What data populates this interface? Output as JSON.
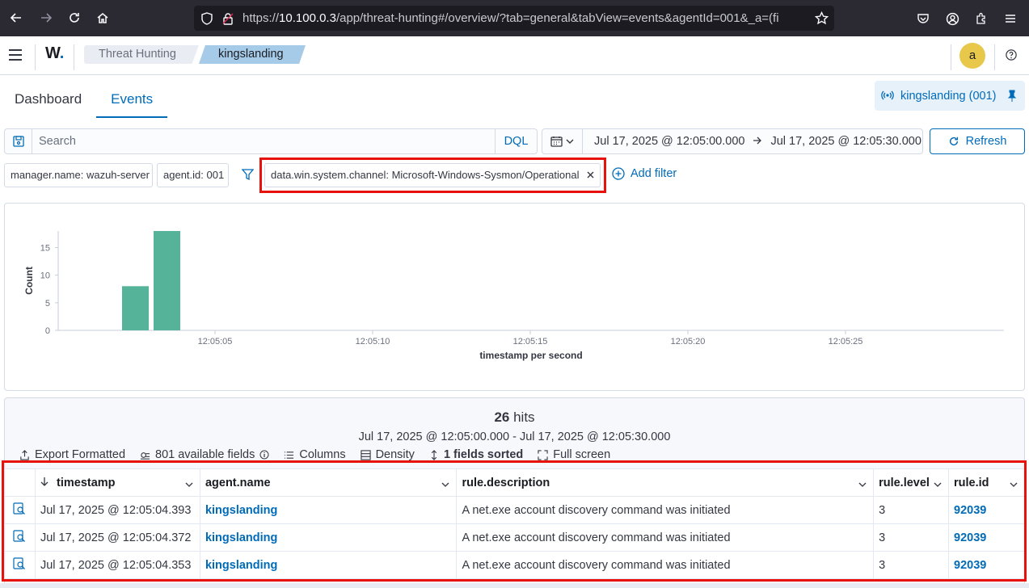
{
  "browser": {
    "url_prefix": "https://",
    "url_host": "10.100.0.3",
    "url_path": "/app/threat-hunting#/overview/?tab=general&tabView=events&agentId=001&_a=(fi"
  },
  "header": {
    "logo_text": "W",
    "logo_dot": ".",
    "breadcrumbs": [
      "Threat Hunting",
      "kingslanding"
    ],
    "avatar_letter": "a"
  },
  "tabs": [
    "Dashboard",
    "Events"
  ],
  "agent_pill": "kingslanding (001)",
  "query": {
    "placeholder": "Search",
    "language": "DQL",
    "date_start": "Jul 17, 2025 @ 12:05:00.000",
    "date_end": "Jul 17, 2025 @ 12:05:30.000",
    "refresh_label": "Refresh"
  },
  "filters": {
    "items": [
      "manager.name: wazuh-server",
      "agent.id: 001",
      "data.win.system.channel: Microsoft-Windows-Sysmon/Operational"
    ],
    "add_label": "Add filter"
  },
  "chart_data": {
    "type": "bar",
    "x": [
      "12:05:03",
      "12:05:04"
    ],
    "values": [
      8,
      18
    ],
    "ylabel": "Count",
    "xlabel": "timestamp per second",
    "y_ticks": [
      0,
      5,
      10,
      15
    ],
    "x_ticks": [
      "12:05:05",
      "12:05:10",
      "12:05:15",
      "12:05:20",
      "12:05:25"
    ],
    "ylim": [
      0,
      18
    ],
    "color": "#54b399"
  },
  "hits": {
    "count": "26",
    "label": "hits",
    "range": "Jul 17, 2025 @ 12:05:00.000 - Jul 17, 2025 @ 12:05:30.000"
  },
  "toolbar": {
    "export": "Export Formatted",
    "fields": "801 available fields",
    "columns": "Columns",
    "density": "Density",
    "sorted": "1 fields sorted",
    "fullscreen": "Full screen"
  },
  "table": {
    "columns": [
      "timestamp",
      "agent.name",
      "rule.description",
      "rule.level",
      "rule.id"
    ],
    "rows": [
      [
        "Jul 17, 2025 @ 12:05:04.393",
        "kingslanding",
        "A net.exe account discovery command was initiated",
        "3",
        "92039"
      ],
      [
        "Jul 17, 2025 @ 12:05:04.372",
        "kingslanding",
        "A net.exe account discovery command was initiated",
        "3",
        "92039"
      ],
      [
        "Jul 17, 2025 @ 12:05:04.353",
        "kingslanding",
        "A net.exe account discovery command was initiated",
        "3",
        "92039"
      ]
    ]
  }
}
